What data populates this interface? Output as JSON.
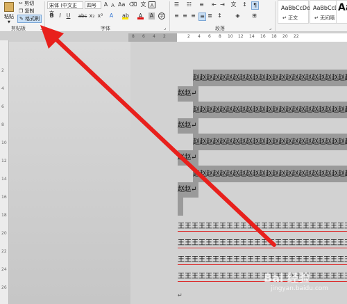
{
  "ribbon": {
    "clipboard": {
      "paste_label": "粘贴",
      "cut_label": "剪切",
      "copy_label": "复制",
      "format_painter_label": "格式刷",
      "group_label": "剪贴板"
    },
    "font": {
      "font_name": "宋体 (中文正文",
      "font_size": "四号",
      "group_label": "字体",
      "buttons": [
        "B",
        "I",
        "U",
        "abc",
        "x₂",
        "x²",
        "A"
      ]
    },
    "paragraph": {
      "group_label": "段落"
    },
    "styles": {
      "cards": [
        {
          "sample": "AaBbCcDd",
          "name": "↵ 正文"
        },
        {
          "sample": "AaBbCcDd",
          "name": "↵ 无间隔"
        },
        {
          "sample": "Aa",
          "name": ""
        }
      ]
    }
  },
  "ruler_top": {
    "ticks": [
      "8",
      "6",
      "4",
      "2",
      "2",
      "4",
      "6",
      "8",
      "10",
      "12",
      "14",
      "16",
      "18",
      "20",
      "22"
    ]
  },
  "ruler_left": {
    "ticks": [
      "2",
      "4",
      "6",
      "8",
      "10",
      "12",
      "14",
      "16",
      "18",
      "20",
      "22",
      "24",
      "26"
    ]
  },
  "document": {
    "zhao_lines": [
      {
        "full": "赵赵赵赵赵赵赵赵赵赵赵赵赵赵赵赵赵赵赵赵赵赵赵赵",
        "tail": "赵赵↵"
      },
      {
        "full": "赵赵赵赵赵赵赵赵赵赵赵赵赵赵赵赵赵赵赵赵赵赵赵赵",
        "tail": "赵赵↵"
      },
      {
        "full": "赵赵赵赵赵赵赵赵赵赵赵赵赵赵赵赵赵赵赵赵赵赵赵赵",
        "tail": "赵赵↵"
      },
      {
        "full": "赵赵赵赵赵赵赵赵赵赵赵赵赵赵赵赵赵赵赵赵赵赵赵赵",
        "tail": "赵赵↵"
      }
    ],
    "wang_lines": [
      "王王王王王王王王王王王王王王王王王王王王王王王王王王",
      "王王王王王王王王王王王王王王王王王王王王王王王王王王",
      "王王王王王王王王王王王王王王王王王王王王王王王王王王",
      "王王王王王王王王王王王王王王王王王王王王王王王王王王"
    ],
    "end_mark": "↵"
  },
  "annotation": {
    "arrow_color": "#e8201c"
  },
  "watermark": {
    "brand": "Bai 经验",
    "url": "jingyan.baidu.com"
  }
}
